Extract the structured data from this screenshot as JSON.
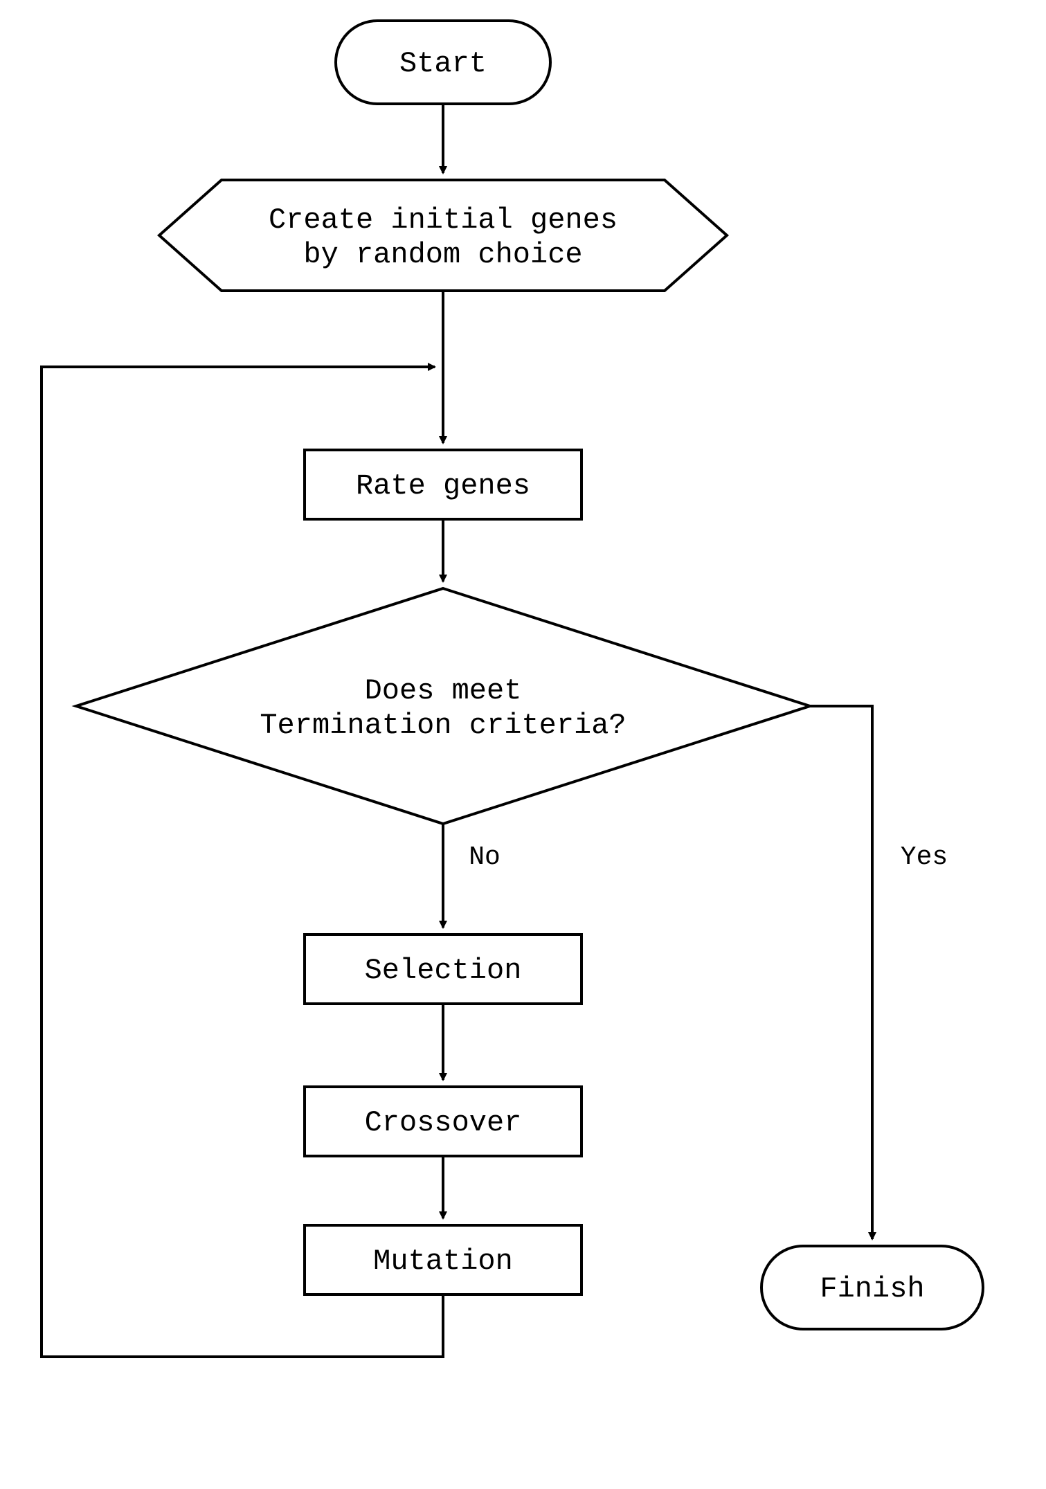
{
  "nodes": {
    "start": "Start",
    "create_line1": "Create initial genes",
    "create_line2": "by random choice",
    "rate": "Rate genes",
    "decision_line1": "Does meet",
    "decision_line2": "Termination criteria?",
    "selection": "Selection",
    "crossover": "Crossover",
    "mutation": "Mutation",
    "finish": "Finish"
  },
  "labels": {
    "no": "No",
    "yes": "Yes"
  }
}
